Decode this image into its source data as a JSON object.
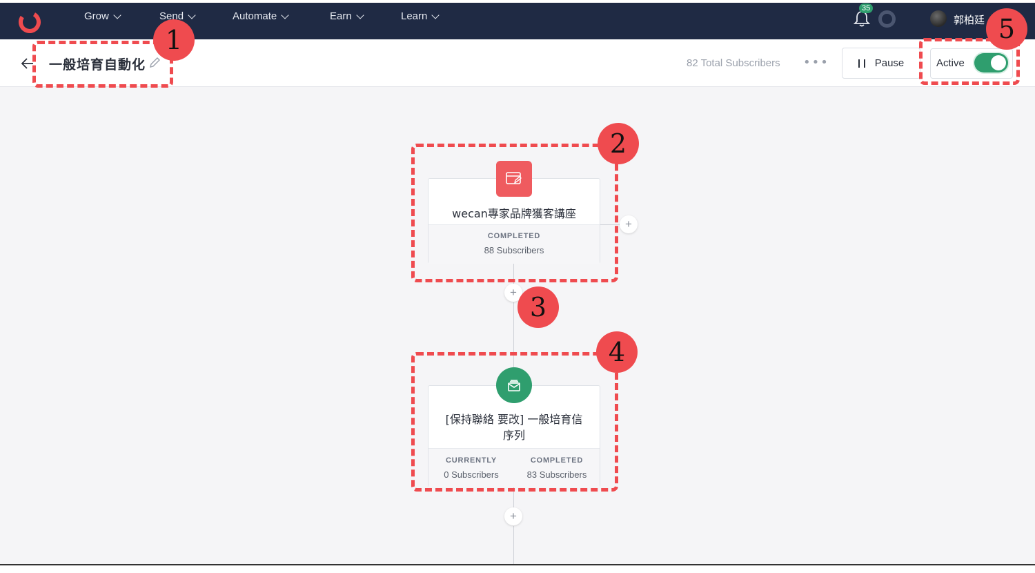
{
  "nav": {
    "items": [
      {
        "label": "Grow"
      },
      {
        "label": "Send"
      },
      {
        "label": "Automate"
      },
      {
        "label": "Earn"
      },
      {
        "label": "Learn"
      }
    ],
    "notification_count": "35",
    "user_name": "郭柏廷",
    "brand_color": "#1f2a44",
    "logo_color": "#ef4b4f"
  },
  "header": {
    "title": "一般培育自動化",
    "total_subscribers": "82 Total Subscribers",
    "more_label": "•••",
    "pause_label": "Pause",
    "active_label": "Active",
    "active_state": true,
    "toggle_color": "#2f9e6e"
  },
  "steps": [
    {
      "name": "wecan專家品牌獲客講座",
      "icon": "form-icon",
      "icon_color": "#ef5b5f",
      "stats": [
        {
          "label": "COMPLETED",
          "value": "88 Subscribers"
        }
      ]
    },
    {
      "name_line1": "[保持聯絡 要改] 一般培育信",
      "name_line2": "序列",
      "icon": "email-sequence-icon",
      "icon_color": "#2f9e6e",
      "stats": [
        {
          "label": "CURRENTLY",
          "value": "0 Subscribers"
        },
        {
          "label": "COMPLETED",
          "value": "83 Subscribers"
        }
      ]
    }
  ],
  "add_step_symbol": "+",
  "annotations": [
    "1",
    "2",
    "3",
    "4",
    "5"
  ],
  "annotation_color": "#ef4b4f"
}
